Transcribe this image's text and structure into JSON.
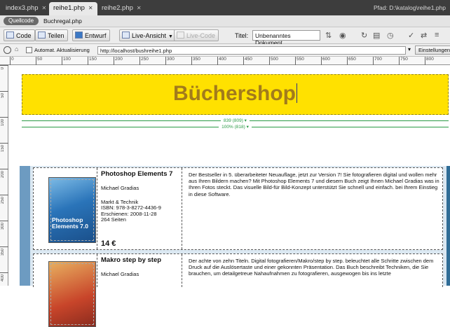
{
  "tabs": [
    {
      "label": "index3.php",
      "active": false
    },
    {
      "label": "reihe1.php",
      "active": true
    },
    {
      "label": "reihe2.php",
      "active": false
    }
  ],
  "path_text": "Pfad: D:\\katalog\\reihe1.php",
  "related": {
    "source_label": "Quellcode",
    "file": "Buchregal.php"
  },
  "doc_toolbar": {
    "code": "Code",
    "split": "Teilen",
    "design": "Entwurf",
    "live_view": "Live-Ansicht",
    "live_code": "Live-Code",
    "title_label": "Titel:",
    "title_value": "Unbenanntes Dokument"
  },
  "address_bar": {
    "auto_refresh": "Automat. Aktualisierung",
    "url": "http://localhost/bushreihe1.php",
    "settings": "Einstellungen..."
  },
  "ruler_marks": [
    "0",
    "50",
    "100",
    "150",
    "200",
    "250",
    "300",
    "350",
    "400",
    "450",
    "500",
    "550",
    "600",
    "650",
    "700",
    "750",
    "800"
  ],
  "page": {
    "heading": "Büchershop",
    "width_1": "839 (809) ▾",
    "width_2": "100% (818) ▾"
  },
  "books": [
    {
      "title": "Photoshop Elements 7",
      "author": "Michael Gradias",
      "publisher": "Markt & Technik",
      "isbn": "ISBN: 978-3-8272-4436-9",
      "date": "Erschienen: 2008-11-28",
      "pages": "264 Seiten",
      "price": "14 €",
      "cover_line1": "Photoshop",
      "cover_line2": "Elements 7.0",
      "description": "Der Bestseller in 5. überarbeiteter Neuauflage, jetzt zur Version 7! Sie fotografieren digital und wollen mehr aus Ihren Bildern machen? Mit Photoshop Elements 7 und diesem Buch zeigt Ihnen Michael Gradias was in Ihren Fotos steckt. Das visuelle Bild-für Bild-Konzept unterstützt Sie schnell und einfach. bei Ihrem Einstieg in diese Software."
    },
    {
      "title": "Makro step by step",
      "author": "Michael Gradias",
      "description": "Der achte von zehn Titeln. Digital fotografieren/Makro/step by step. beleuchtet alle Schritte zwischen dem Druck auf die Auslösertaste und einer gekonnten Präsentation. Das Buch beschreibt Techniken, die Sie brauchen, um detailgetreue Nahaufnahmen zu fotografieren, ausgewogen bis ins letzte"
    }
  ],
  "colors": {
    "header_bg": "#ffe100",
    "heading": "#a27b1c",
    "tab_bar": "#3d3d3d",
    "guide_green": "#2a9a45",
    "side_blue": "#6d9bc1"
  }
}
